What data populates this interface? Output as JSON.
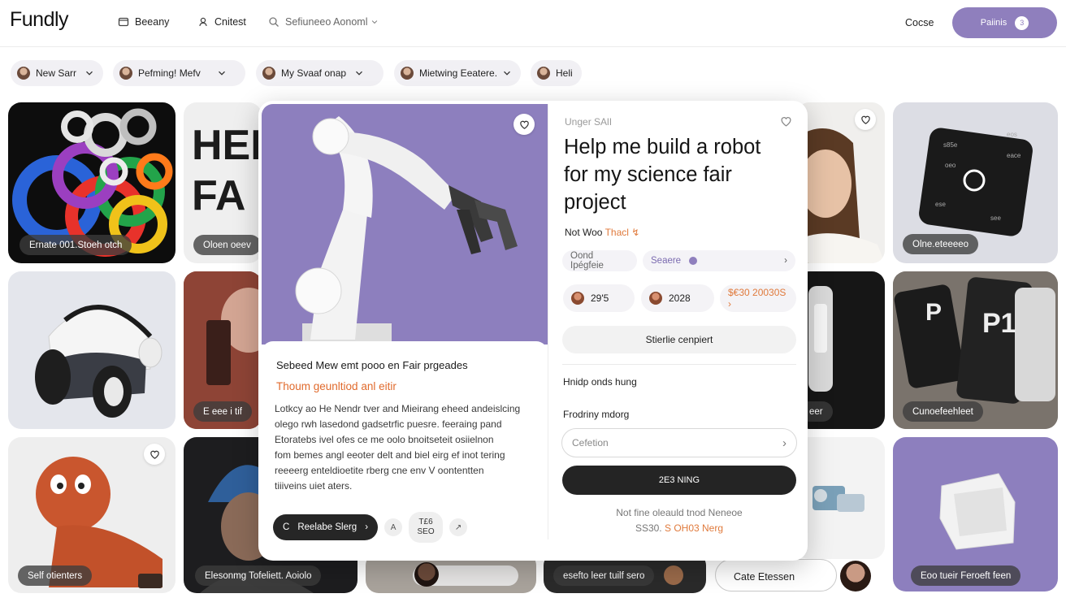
{
  "app": {
    "logo": "Fundly"
  },
  "nav": {
    "items": [
      {
        "label": "Beeany",
        "icon": "square-icon"
      },
      {
        "label": "Cnitest",
        "icon": "user-icon"
      }
    ],
    "search_placeholder": "Sefiuneeo Aonoml",
    "link": "Cocse",
    "cta_label": "Paiinis",
    "cta_count": "3"
  },
  "chips": [
    {
      "label": "New Sarr"
    },
    {
      "label": "Pefming! Mefv"
    },
    {
      "label": "My Svaaf onap"
    },
    {
      "label": "Mietwing Eeatere."
    },
    {
      "label": "Heli"
    }
  ],
  "tiles": {
    "t1_tag": "Ernate 001.Stoeh otch",
    "t2_big": "HEI\nFA",
    "t2_tag": "Oloen oeev",
    "t3_tag": "Olne.eteeeeo",
    "t5_tag": "E eee i tif",
    "t6_tag": "Cunoefeehleet",
    "t4_tag": "eer",
    "t7_tag": "Self otienters",
    "t8_tag": "Elesonmg Tofeliett. Aoiolo",
    "t9_tag": "esefto leer tuilf sero",
    "t10_label": "Cate Etessen",
    "t11_tag": "Eoo tueir Feroeft feen",
    "cube_labels": [
      "s85e",
      "eos",
      "eace",
      "ese",
      "see",
      "oeo"
    ]
  },
  "modal": {
    "heading": "Sebeed Mew emt pooo en Fair prgeades",
    "accent": "Thoum geunltiod anl eitir",
    "body_lines": [
      "Lotkcy ao He Nendr tver and Mieirang eheed andeislcing",
      "olego rwh lasedond gadsetrfic puesre. feeraing pand",
      "Etoratebs ivel ofes ce me oolo bnoitseteit osiielnon",
      "fom bemes angl eeoter delt and biel eirg ef inot tering",
      "reeeerg enteldioetite rberg cne env V oontentten",
      "tiiiveins uiet aters."
    ],
    "action_label": "Reelabe Slerg",
    "stat_top": "T£6",
    "stat_bottom": "SEO",
    "sub_title": "Unger SAlI",
    "title": "Help me build a robot for my science fair project",
    "meta_main": "Not Woo",
    "meta_accent": "Thacl ↯",
    "pill_left": "Oond Ipégfeie",
    "pill_right": "Seaere",
    "stats": [
      {
        "label": "29'5"
      },
      {
        "label": "2028"
      },
      {
        "label": "$€30 20030S ›"
      }
    ],
    "wide_button": "Stierlie cenpiert",
    "section_label_1": "Hnidp onds hung",
    "section_label_2": "Frodriny mdorg",
    "input_placeholder": "Cefetion",
    "dark_button": "2E3 NING",
    "note_line_1": "Not fine oleauld tnod Neneoe",
    "note_line_2_main": "SS30.",
    "note_line_2_accent": "S OH03 Nerg"
  },
  "colors": {
    "accent_purple": "#8f7fbd",
    "accent_orange": "#e06a2c",
    "dark": "#242424"
  }
}
